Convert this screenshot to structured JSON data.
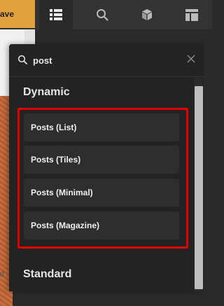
{
  "toolbar": {
    "save_label": "ave",
    "tabs": [
      {
        "icon": "list-icon",
        "active": true
      },
      {
        "icon": "search-icon",
        "active": false
      },
      {
        "icon": "cube-icon",
        "active": false
      },
      {
        "icon": "layout-icon",
        "active": false
      }
    ]
  },
  "canvas": {
    "partial_text": "at"
  },
  "search": {
    "value": "post",
    "placeholder": ""
  },
  "sections": {
    "dynamic_title": "Dynamic",
    "standard_title": "Standard"
  },
  "dynamic_items": [
    {
      "label": "Posts (List)"
    },
    {
      "label": "Posts (Tiles)"
    },
    {
      "label": "Posts (Minimal)"
    },
    {
      "label": "Posts (Magazine)"
    }
  ],
  "colors": {
    "accent": "#e2a13a",
    "highlight": "#e00000",
    "panel_bg": "#232323",
    "item_bg": "#2e2e2e"
  }
}
